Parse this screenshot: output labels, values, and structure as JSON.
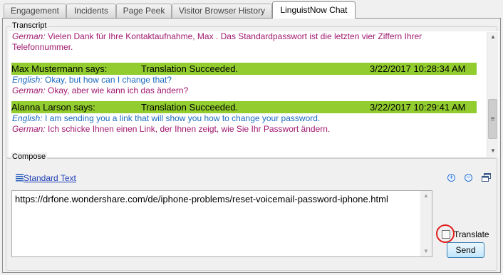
{
  "tabs": [
    {
      "label": "Engagement"
    },
    {
      "label": "Incidents"
    },
    {
      "label": "Page Peek"
    },
    {
      "label": "Visitor Browser History"
    },
    {
      "label": "LinguistNow Chat"
    }
  ],
  "transcript": {
    "group_label": "Transcript",
    "partial_top": {
      "lang_label": "German:",
      "line1": " Vielen Dank für Ihre Kontaktaufnahme, Max . Das Standardpasswort ist die letzten vier Ziffern Ihrer",
      "line2": "Telefonnummer."
    },
    "messages": [
      {
        "sender": "Max Mustermann says:",
        "status": "Translation Succeeded.",
        "timestamp": "3/22/2017 10:28:34 AM",
        "english_label": "English:",
        "english_text": " Okay, but how can I change that?",
        "german_label": "German:",
        "german_text": " Okay, aber wie kann ich das ändern?"
      },
      {
        "sender": "Alanna Larson says:",
        "status": "Translation Succeeded.",
        "timestamp": "3/22/2017 10:29:41 AM",
        "english_label": "English:",
        "english_text": " I am sending you a link that will show you how to change your password.",
        "german_label": "German:",
        "german_text": " Ich schicke Ihnen einen Link, der Ihnen zeigt, wie Sie Ihr Passwort ändern."
      }
    ]
  },
  "compose": {
    "group_label": "Compose",
    "standard_text_label": "Standard Text",
    "message_value": "https://drfone.wondershare.com/de/iphone-problems/reset-voicemail-password-iphone.html",
    "translate_label": "Translate",
    "translate_checked": false,
    "send_label": "Send"
  },
  "colors": {
    "header_bar": "#92cc2e",
    "english_text": "#1a6ac2",
    "german_text": "#a0186e",
    "highlight_circle": "#e02020"
  }
}
